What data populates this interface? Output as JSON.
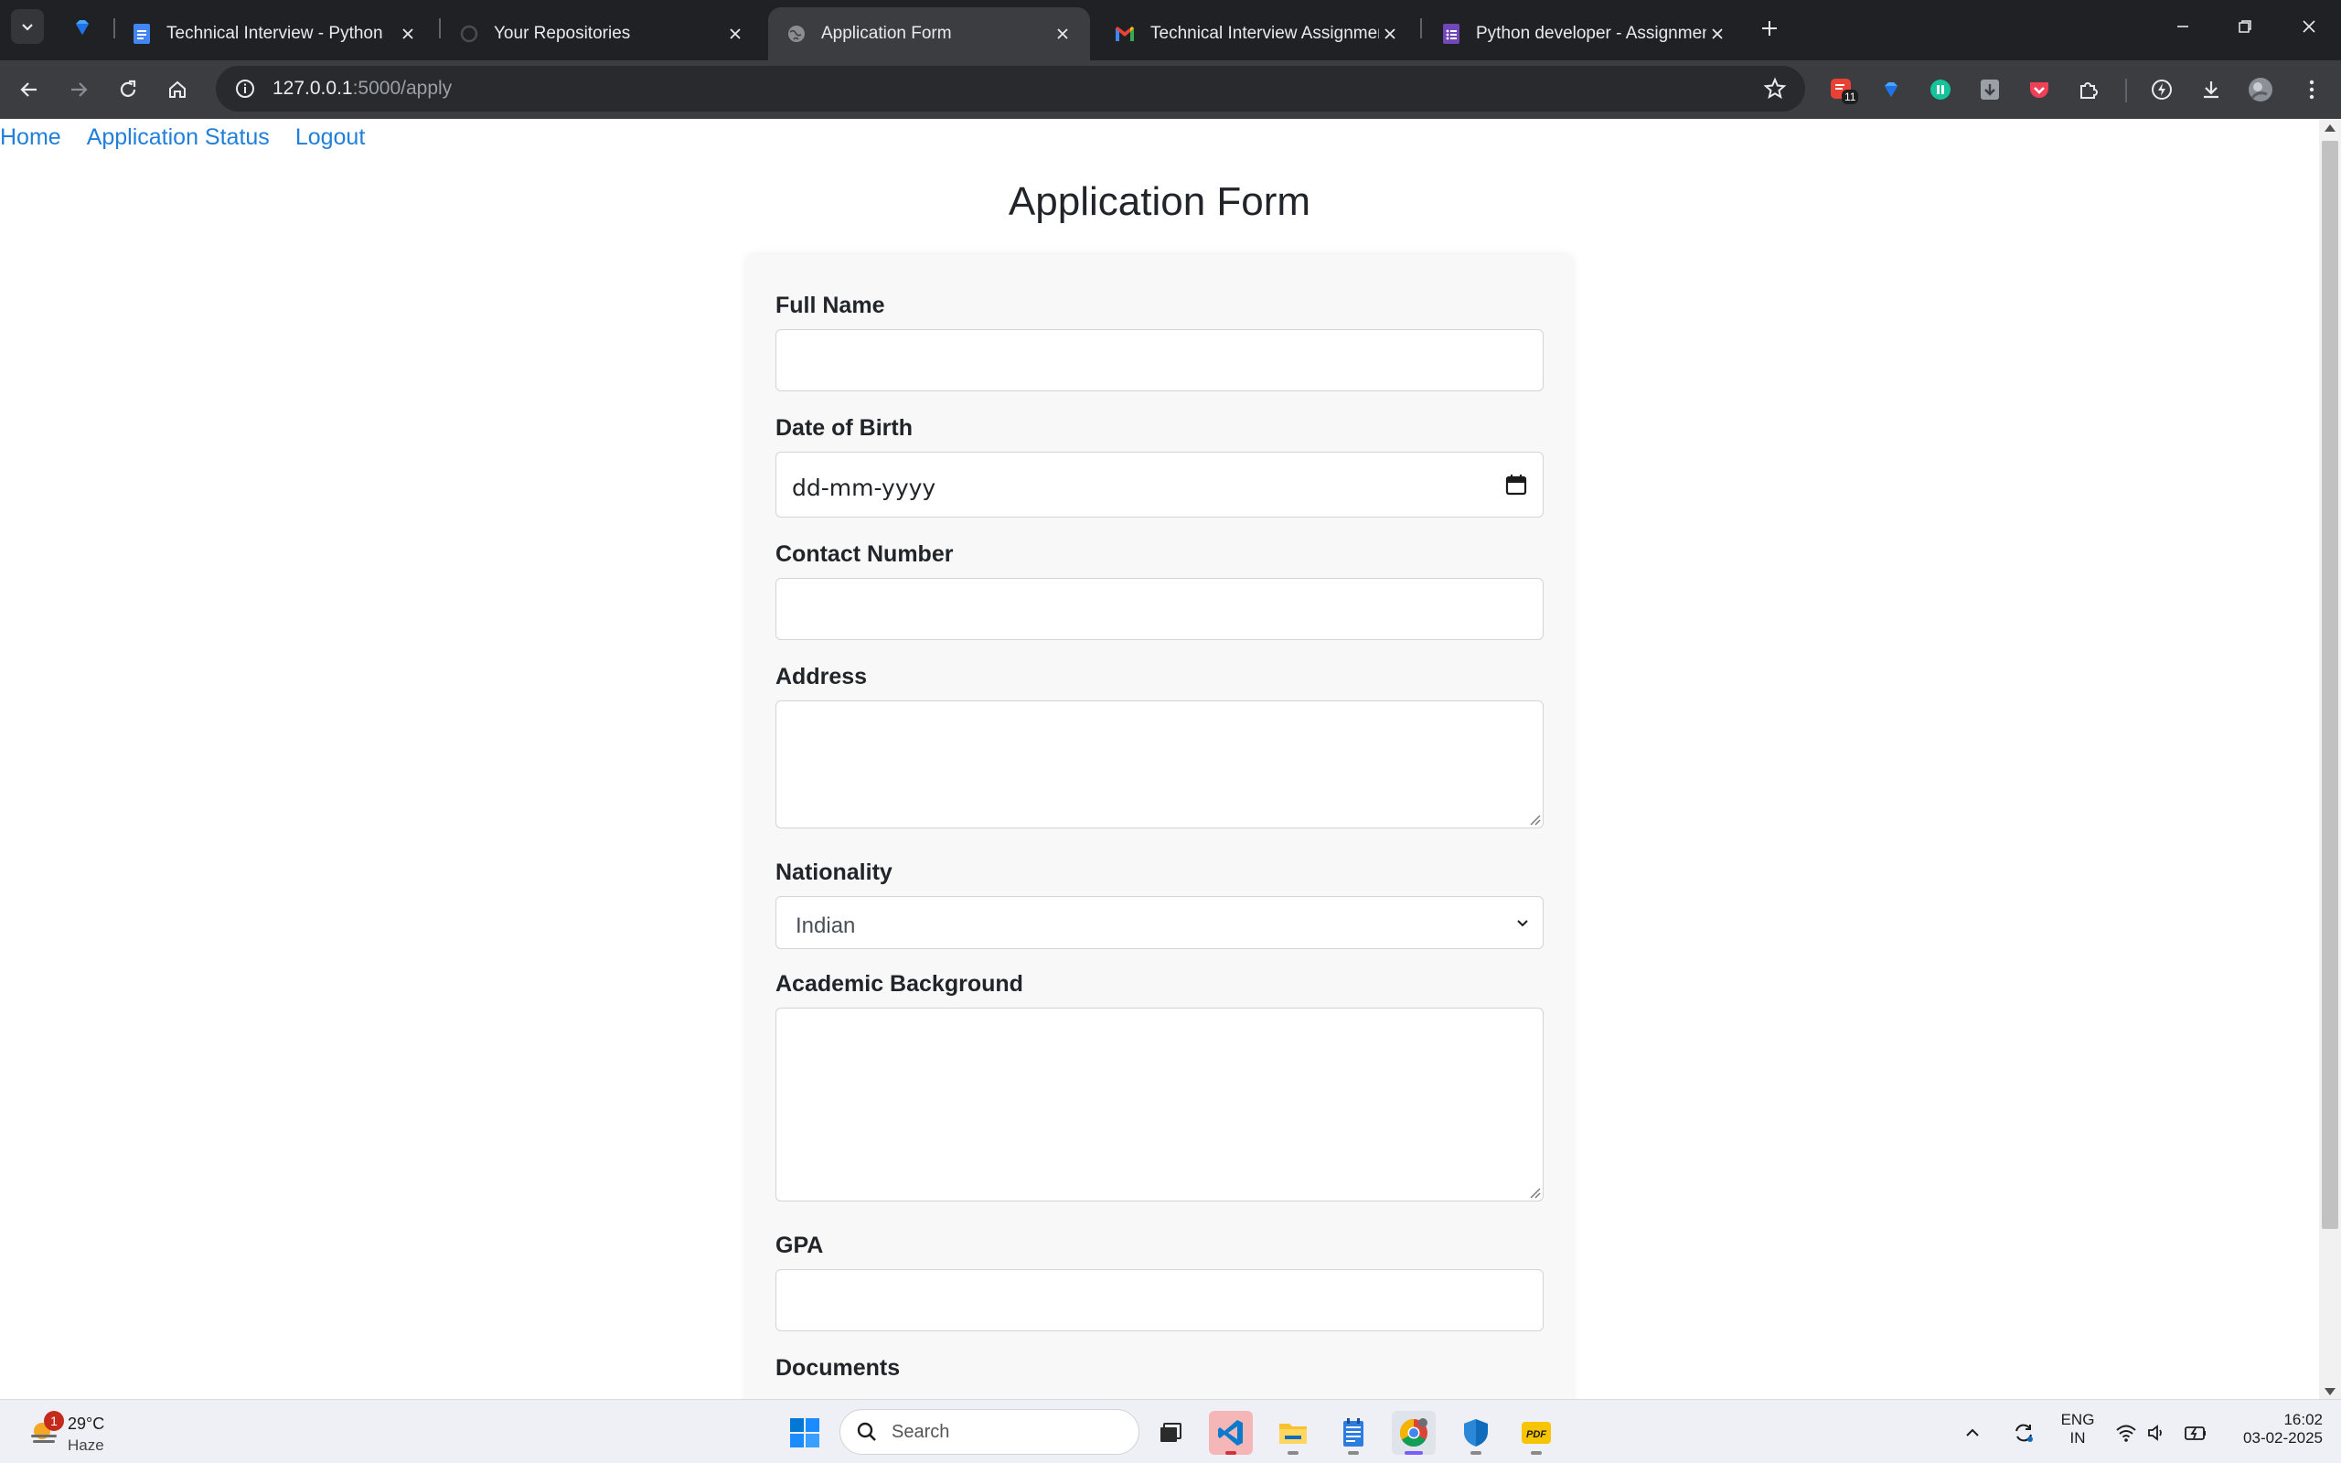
{
  "browser": {
    "tabs": [
      {
        "title": "Technical Interview - Python",
        "icon": "google-docs-icon"
      },
      {
        "title": "Your Repositories",
        "icon": "loading-spinner-icon"
      },
      {
        "title": "Application Form",
        "icon": "globe-icon",
        "active": true
      },
      {
        "title": "Technical Interview Assignment",
        "icon": "gmail-icon"
      },
      {
        "title": "Python developer - Assignment",
        "icon": "google-forms-icon"
      }
    ],
    "url_host": "127.0.0.1",
    "url_path": ":5000/apply",
    "extension_badge": "11"
  },
  "nav": {
    "home": "Home",
    "status": "Application Status",
    "logout": "Logout"
  },
  "form": {
    "title": "Application Form",
    "full_name_label": "Full Name",
    "full_name_value": "",
    "dob_label": "Date of Birth",
    "dob_placeholder": "dd-mm-yyyy",
    "contact_label": "Contact Number",
    "contact_value": "",
    "address_label": "Address",
    "address_value": "",
    "nationality_label": "Nationality",
    "nationality_value": "Indian",
    "academic_label": "Academic Background",
    "academic_value": "",
    "gpa_label": "GPA",
    "gpa_value": "",
    "documents_label": "Documents"
  },
  "taskbar": {
    "weather_badge": "1",
    "temperature": "29°C",
    "condition": "Haze",
    "search_placeholder": "Search",
    "language_line1": "ENG",
    "language_line2": "IN",
    "time": "16:02",
    "date": "03-02-2025"
  },
  "colors": {
    "link": "#1f7fdb",
    "tabstrip": "#202124",
    "toolbar": "#3c3d41",
    "card_bg": "#f8f8f8"
  }
}
